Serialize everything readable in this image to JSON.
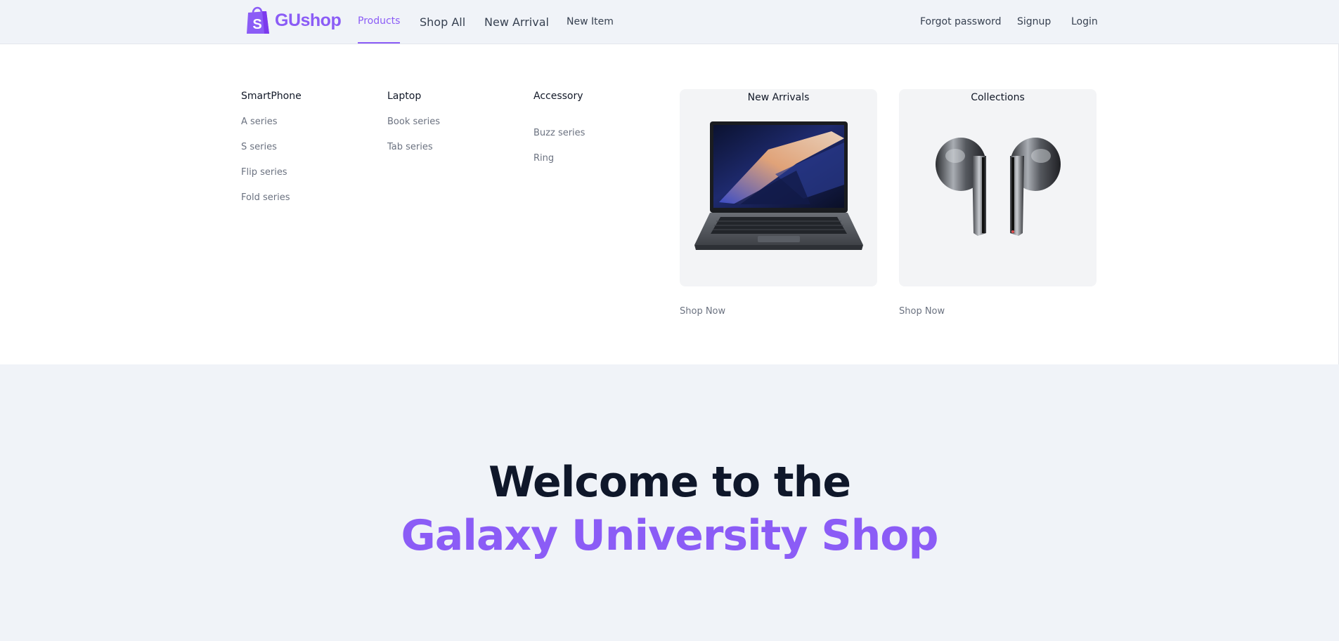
{
  "brand": {
    "name": "GUshop",
    "accent_color": "#8b5cf6",
    "logo_icon": "shopping-bag-icon"
  },
  "nav": {
    "products": "Products",
    "shop_all": "Shop All",
    "new_arrival": "New Arrival",
    "new_item": "New Item",
    "forgot_password": "Forgot password",
    "signup": "Signup",
    "login": "Login"
  },
  "menu": {
    "columns": [
      {
        "title": "SmartPhone",
        "links": [
          "A series",
          "S series",
          "Flip series",
          "Fold series"
        ]
      },
      {
        "title": "Laptop",
        "links": [
          "Book series",
          "Tab series"
        ]
      },
      {
        "title": "Accessory",
        "links": [
          "Buzz series",
          "Ring"
        ]
      }
    ],
    "features": [
      {
        "title": "New Arrivals",
        "image": "laptop-image",
        "cta": "Shop Now"
      },
      {
        "title": "Collections",
        "image": "earbuds-image",
        "cta": "Shop Now"
      }
    ]
  },
  "hero": {
    "line1": "Welcome to the",
    "line2": "Galaxy University Shop"
  }
}
